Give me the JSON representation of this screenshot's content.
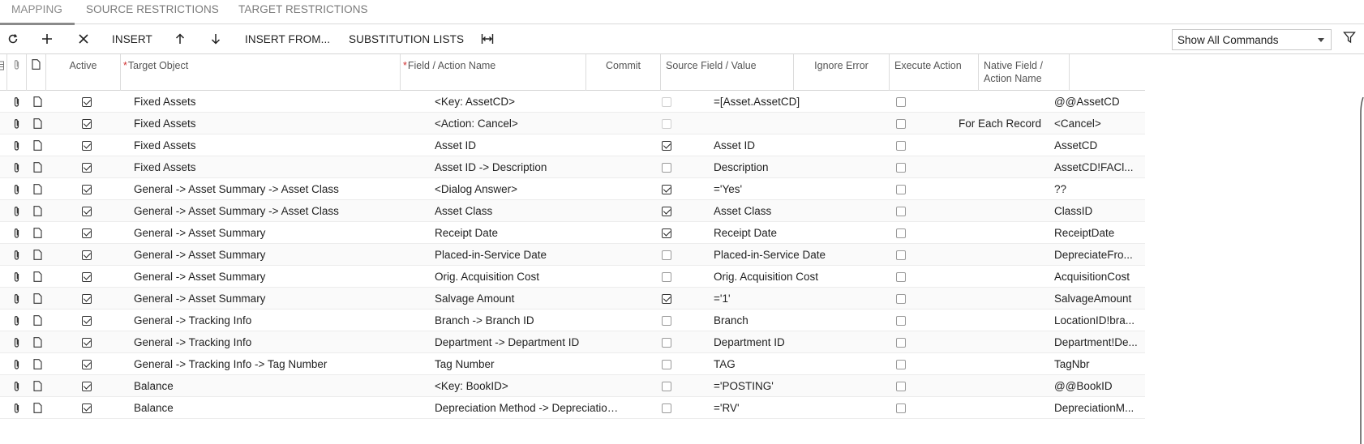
{
  "tabs": [
    {
      "label": "MAPPING",
      "active": true
    },
    {
      "label": "SOURCE RESTRICTIONS",
      "active": false
    },
    {
      "label": "TARGET RESTRICTIONS",
      "active": false
    }
  ],
  "toolbar": {
    "refresh_icon": "refresh-icon",
    "add_icon": "plus-icon",
    "delete_icon": "close-icon",
    "insert_label": "INSERT",
    "move_up_icon": "arrow-up-icon",
    "move_down_icon": "arrow-down-icon",
    "insert_from_label": "INSERT FROM...",
    "substitution_lists_label": "SUBSTITUTION LISTS",
    "fit_columns_icon": "fit-columns-icon",
    "commands_select_value": "Show All Commands",
    "filter_icon": "filter-icon"
  },
  "columns": {
    "active": "Active",
    "target_object": "Target Object",
    "field_action": "Field / Action Name",
    "commit": "Commit",
    "source_field": "Source Field / Value",
    "ignore_error": "Ignore Error",
    "execute_action": "Execute Action",
    "native_field_line1": "Native Field /",
    "native_field_line2": "Action Name"
  },
  "rows": [
    {
      "active": true,
      "target": "Fixed Assets",
      "field": "<Key: AssetCD>",
      "commit": false,
      "commit_disabled": true,
      "source": "=[Asset.AssetCD]",
      "ignore": false,
      "execute": "",
      "native": "@@AssetCD"
    },
    {
      "active": true,
      "target": "Fixed Assets",
      "field": "<Action: Cancel>",
      "commit": false,
      "commit_disabled": true,
      "source": "",
      "ignore": false,
      "execute": "For Each Record",
      "native": "<Cancel>"
    },
    {
      "active": true,
      "target": "Fixed Assets",
      "field": "Asset ID",
      "commit": true,
      "commit_disabled": false,
      "source": "Asset ID",
      "ignore": false,
      "execute": "",
      "native": "AssetCD"
    },
    {
      "active": true,
      "target": "Fixed Assets",
      "field": "Asset ID -> Description",
      "commit": false,
      "commit_disabled": false,
      "source": "Description",
      "ignore": false,
      "execute": "",
      "native": "AssetCD!FACl..."
    },
    {
      "active": true,
      "target": "General -> Asset Summary -> Asset Class",
      "field": "<Dialog Answer>",
      "commit": true,
      "commit_disabled": false,
      "source": "='Yes'",
      "ignore": false,
      "execute": "",
      "native": "??"
    },
    {
      "active": true,
      "target": "General -> Asset Summary -> Asset Class",
      "field": "Asset Class",
      "commit": true,
      "commit_disabled": false,
      "source": "Asset Class",
      "ignore": false,
      "execute": "",
      "native": "ClassID"
    },
    {
      "active": true,
      "target": "General -> Asset Summary",
      "field": "Receipt Date",
      "commit": true,
      "commit_disabled": false,
      "source": "Receipt Date",
      "ignore": false,
      "execute": "",
      "native": "ReceiptDate"
    },
    {
      "active": true,
      "target": "General -> Asset Summary",
      "field": "Placed-in-Service Date",
      "commit": false,
      "commit_disabled": false,
      "source": "Placed-in-Service Date",
      "ignore": false,
      "execute": "",
      "native": "DepreciateFro..."
    },
    {
      "active": true,
      "target": "General -> Asset Summary",
      "field": "Orig. Acquisition Cost",
      "commit": false,
      "commit_disabled": false,
      "source": "Orig. Acquisition Cost",
      "ignore": false,
      "execute": "",
      "native": "AcquisitionCost"
    },
    {
      "active": true,
      "target": "General -> Asset Summary",
      "field": "Salvage Amount",
      "commit": true,
      "commit_disabled": false,
      "source": "='1'",
      "ignore": false,
      "execute": "",
      "native": "SalvageAmount"
    },
    {
      "active": true,
      "target": "General -> Tracking Info",
      "field": "Branch -> Branch ID",
      "commit": false,
      "commit_disabled": false,
      "source": "Branch",
      "ignore": false,
      "execute": "",
      "native": "LocationID!bra..."
    },
    {
      "active": true,
      "target": "General -> Tracking Info",
      "field": "Department -> Department ID",
      "commit": false,
      "commit_disabled": false,
      "source": "Department ID",
      "ignore": false,
      "execute": "",
      "native": "Department!De..."
    },
    {
      "active": true,
      "target": "General -> Tracking Info -> Tag Number",
      "field": "Tag Number",
      "commit": false,
      "commit_disabled": false,
      "source": "TAG",
      "ignore": false,
      "execute": "",
      "native": "TagNbr"
    },
    {
      "active": true,
      "target": "Balance",
      "field": "<Key: BookID>",
      "commit": false,
      "commit_disabled": false,
      "source": "='POSTING'",
      "ignore": false,
      "execute": "",
      "native": "@@BookID"
    },
    {
      "active": true,
      "target": "Balance",
      "field": "Depreciation Method -> Depreciation...",
      "commit": false,
      "commit_disabled": false,
      "source": "='RV'",
      "ignore": false,
      "execute": "",
      "native": "DepreciationM..."
    }
  ]
}
